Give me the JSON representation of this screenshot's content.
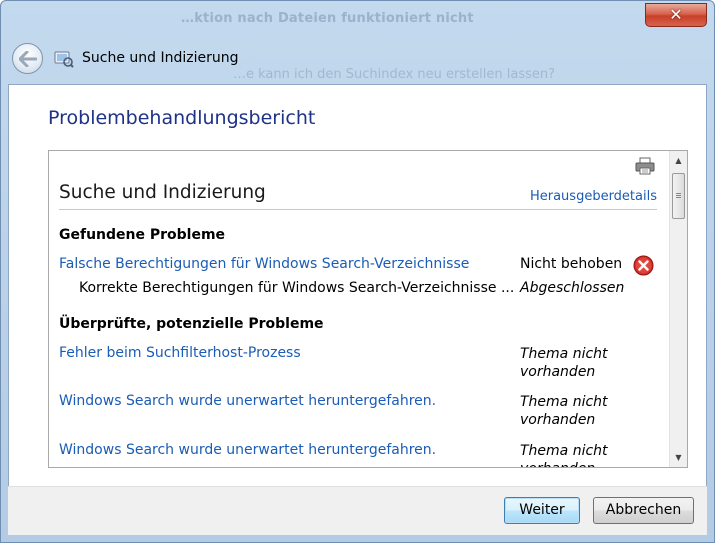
{
  "window": {
    "background_title": "…ktion nach Dateien funktioniert nicht",
    "background_subtitle": "…e kann ich den Suchindex neu erstellen lassen?",
    "close_label": "✕",
    "app_title": "Suche und Indizierung"
  },
  "main": {
    "heading": "Problembehandlungsbericht"
  },
  "report": {
    "section_title": "Suche und Indizierung",
    "publisher_link": "Herausgeberdetails",
    "found_header": "Gefundene Probleme",
    "found_items": [
      {
        "label": "Falsche Berechtigungen für Windows Search-Verzeichnisse",
        "status": "Nicht behoben",
        "icon": "error-icon"
      },
      {
        "label": "Korrekte Berechtigungen für Windows Search-Verzeichnisse ...",
        "status": "Abgeschlossen"
      }
    ],
    "checked_header": "Überprüfte, potenzielle Probleme",
    "checked_items": [
      {
        "label": "Fehler beim Suchfilterhost-Prozess",
        "status": "Thema nicht vorhanden"
      },
      {
        "label": "Windows Search wurde unerwartet heruntergefahren.",
        "status": "Thema nicht vorhanden"
      },
      {
        "label": "Windows Search wurde unerwartet heruntergefahren.",
        "status": "Thema nicht vorhanden"
      }
    ]
  },
  "footer": {
    "next_button": "Weiter",
    "cancel_button": "Abbrechen"
  },
  "colors": {
    "link": "#1a5cb6",
    "heading": "#1e3287",
    "error": "#d8302b"
  }
}
